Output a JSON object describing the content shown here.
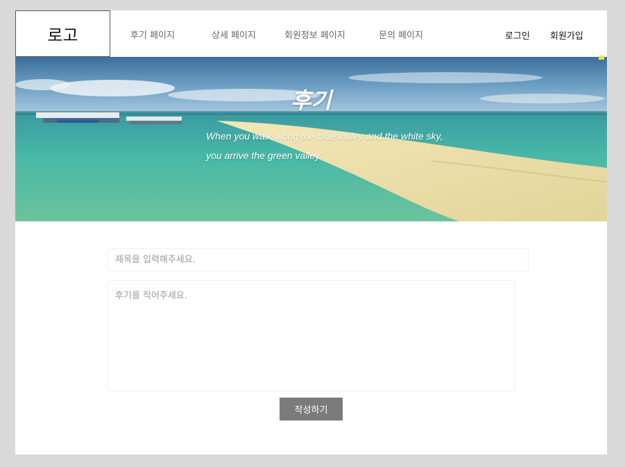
{
  "header": {
    "logo": "로고",
    "nav": [
      {
        "label": "후기 페이지"
      },
      {
        "label": "상세 페이지"
      },
      {
        "label": "회원정보 페이지"
      },
      {
        "label": "문의 페이지"
      }
    ],
    "auth": {
      "login": "로그인",
      "signup": "회원가입"
    }
  },
  "hero": {
    "title": "후기",
    "subtitle_line1": "When you walk along the blue valley and the white sky,",
    "subtitle_line2": "you arrive the green valley."
  },
  "form": {
    "title_placeholder": "제목을 입력해주세요.",
    "content_placeholder": "후기를 적어주세요.",
    "submit_label": "작성하기"
  },
  "colors": {
    "background": "#d9d9d9",
    "button": "#7b7b7b"
  }
}
